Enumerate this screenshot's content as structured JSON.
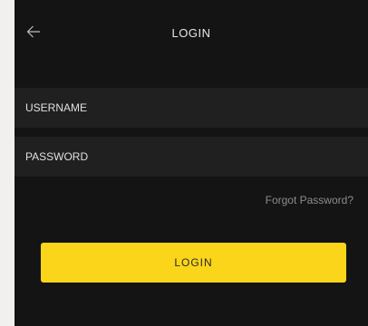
{
  "header": {
    "title": "LOGIN",
    "back_icon": "arrow-left-icon"
  },
  "form": {
    "username_placeholder": "USERNAME",
    "password_placeholder": "PASSWORD",
    "forgot_password_label": "Forgot Password?",
    "login_button_label": "LOGIN"
  },
  "colors": {
    "background": "#141414",
    "field_background": "#202020",
    "accent": "#fad519",
    "muted_text": "#8c8c8c"
  }
}
